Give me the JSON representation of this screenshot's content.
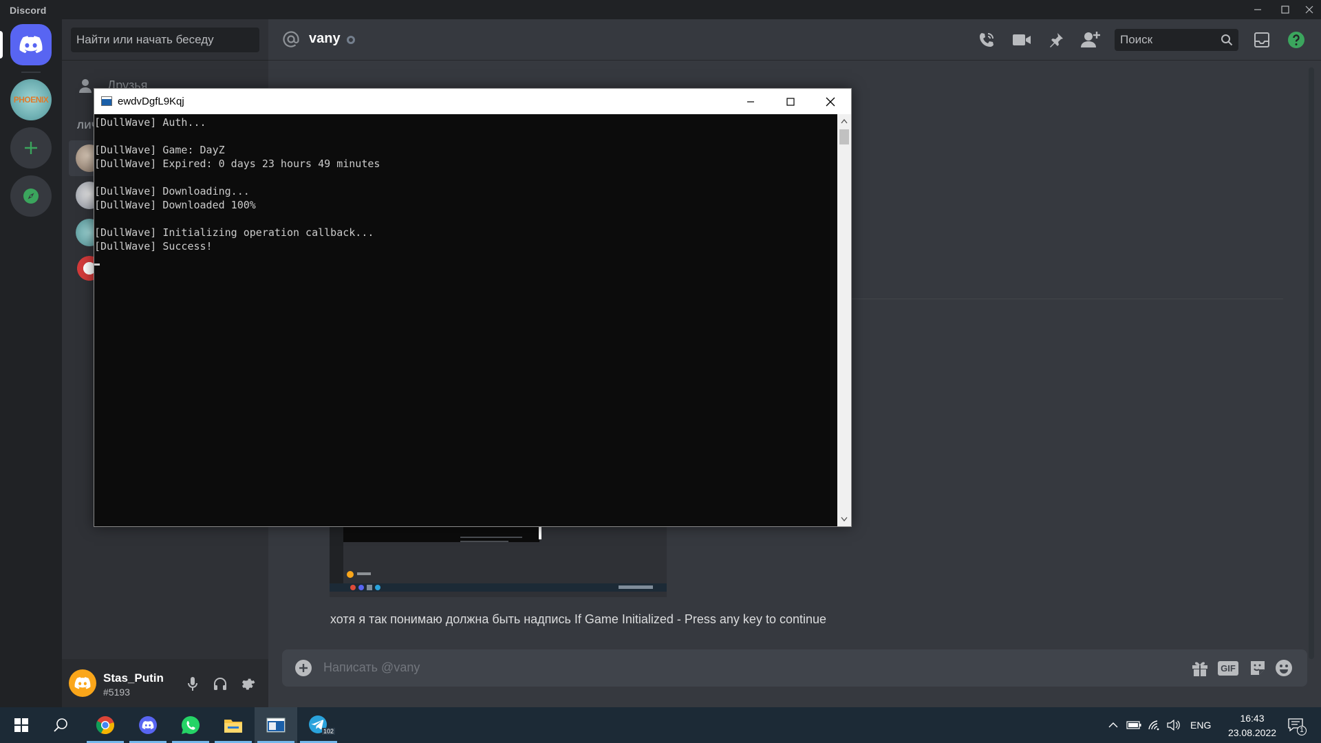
{
  "app": {
    "name": "Discord"
  },
  "servers": [
    {
      "name": "home",
      "icon": "discord-logo-icon"
    },
    {
      "name": "phoenix",
      "label": "PHOENIX"
    },
    {
      "name": "add-server",
      "icon": "plus-icon"
    },
    {
      "name": "explore",
      "icon": "compass-icon"
    }
  ],
  "sidebar": {
    "search_placeholder": "Найти или начать беседу",
    "friends_label": "Друзья",
    "dm_header": "ЛИЧ"
  },
  "user": {
    "name": "Stas_Putin",
    "tag": "#5193"
  },
  "chat": {
    "channel": "vany",
    "search_placeholder": "Поиск",
    "message": "хотя я так понимаю должна быть надпись If Game Initialized - Press any key to continue",
    "composer_placeholder": "Написать @vany",
    "gif_label": "GIF"
  },
  "console": {
    "title": "ewdvDgfL9Kqj",
    "lines": [
      "[DullWave] Auth...",
      "",
      "[DullWave] Game: DayZ",
      "[DullWave] Expired: 0 days 23 hours 49 minutes",
      "",
      "[DullWave] Downloading...",
      "[DullWave] Downloaded 100%",
      "",
      "[DullWave] Initializing operation callback...",
      "[DullWave] Success!",
      ""
    ]
  },
  "taskbar": {
    "apps": [
      "windows-start-icon",
      "search-icon",
      "chrome-icon",
      "discord-icon",
      "whatsapp-icon",
      "file-explorer-icon",
      "console-icon",
      "telegram-icon"
    ],
    "telegram_badge": "102",
    "language": "ENG",
    "time": "16:43",
    "date": "23.08.2022",
    "notification_count": "1"
  },
  "colors": {
    "blurple": "#5865f2",
    "background": "#36393f",
    "sidebar": "#2f3136",
    "rail": "#202225",
    "taskbar": "#1c2a36",
    "console_bg": "#0c0c0c"
  }
}
